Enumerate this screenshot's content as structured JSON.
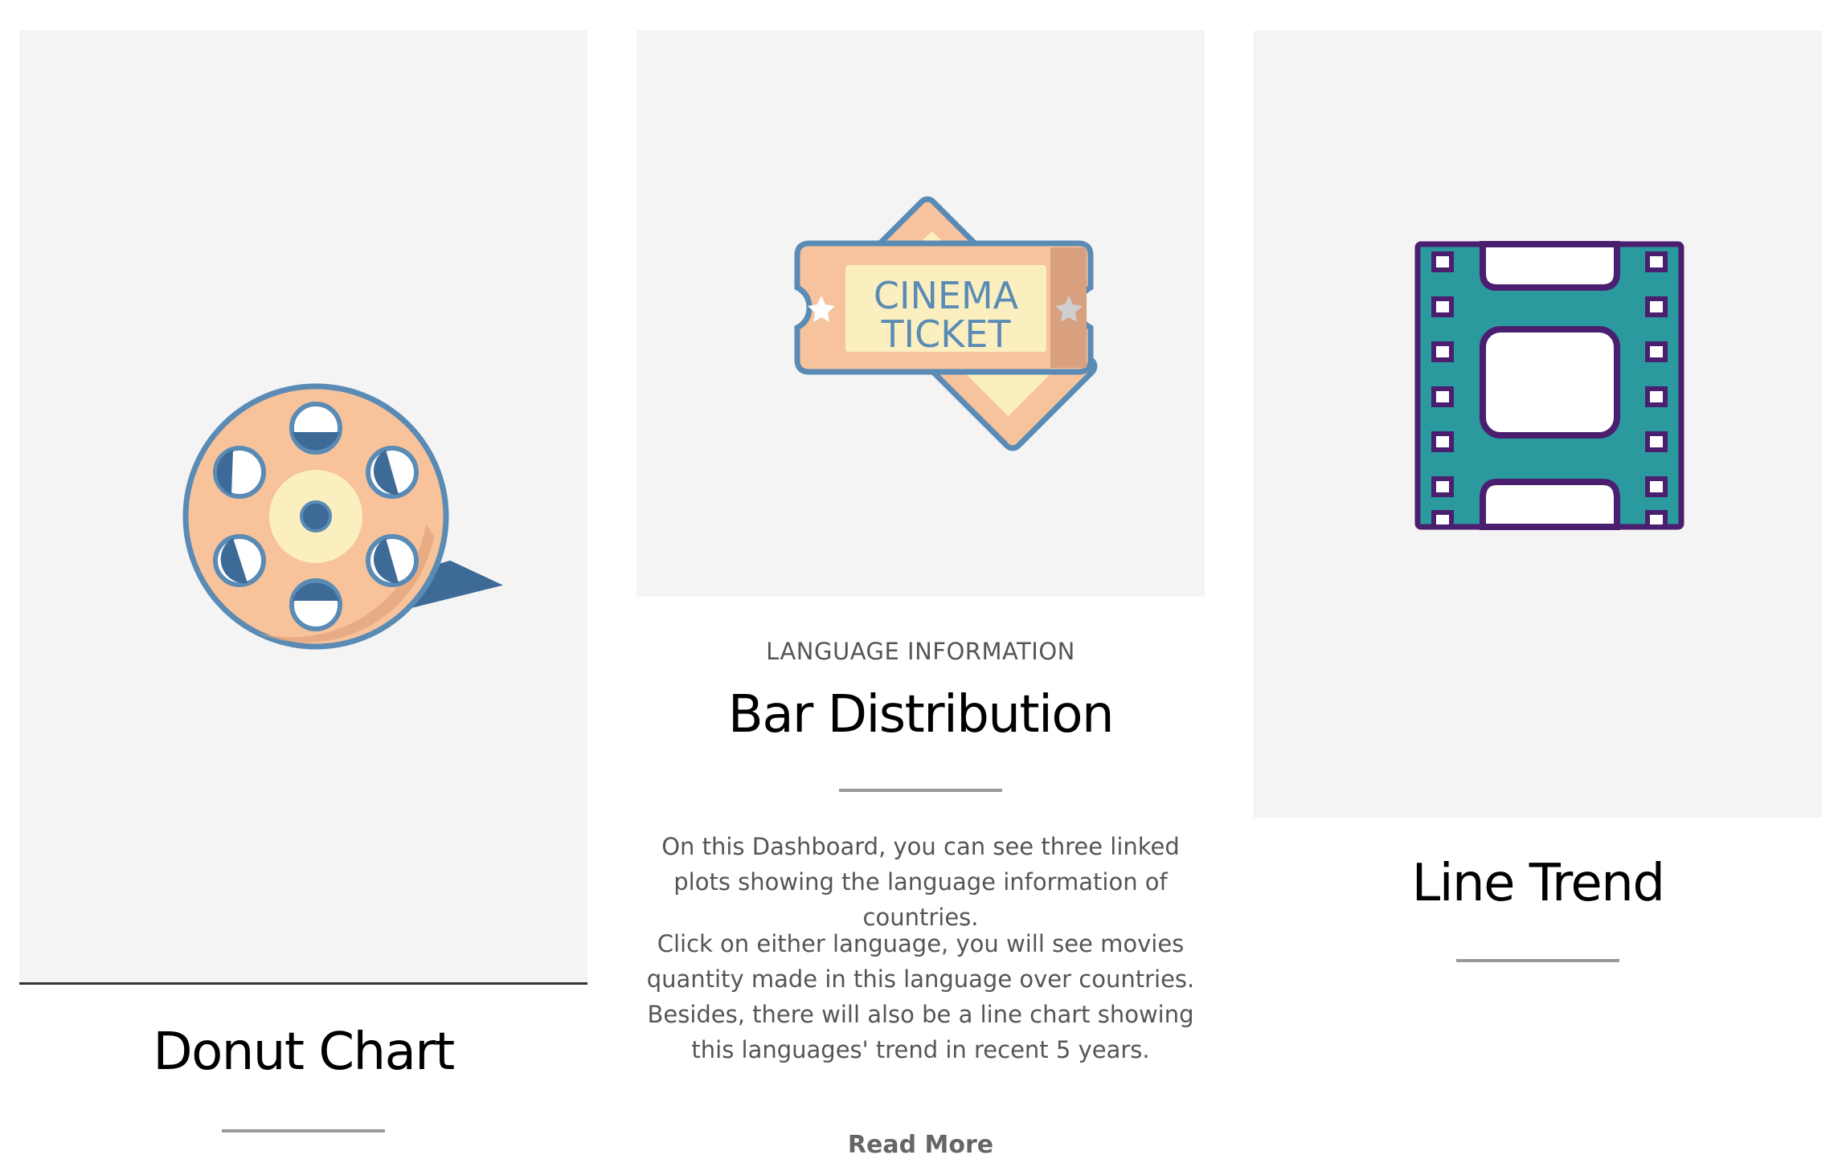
{
  "cards": [
    {
      "title": "Donut Chart",
      "icon": "film-reel-icon"
    },
    {
      "category": "LANGUAGE INFORMATION",
      "title": "Bar Distribution",
      "icon": "cinema-ticket-icon",
      "ticket_text_line1": "CINEMA",
      "ticket_text_line2": "TICKET",
      "paragraph1": "On this Dashboard, you can see three linked plots showing the language information of countries.",
      "paragraph2": "Click on either language, you will see movies quantity made in this language over countries. Besides, there will also be a line chart showing this languages' trend in recent 5 years.",
      "read_more": "Read More"
    },
    {
      "title": "Line Trend",
      "icon": "film-strip-icon"
    }
  ],
  "colors": {
    "card_bg": "#f4f4f4",
    "title": "#000000",
    "body_text": "#555555",
    "divider": "#999999",
    "reel_body": "#f8c29a",
    "reel_outline": "#5a8bb5",
    "ticket_body": "#f6c39d",
    "ticket_label": "#fbefc0",
    "film_strip": "#2b9a9e",
    "film_strip_outline": "#4a1f6f"
  }
}
